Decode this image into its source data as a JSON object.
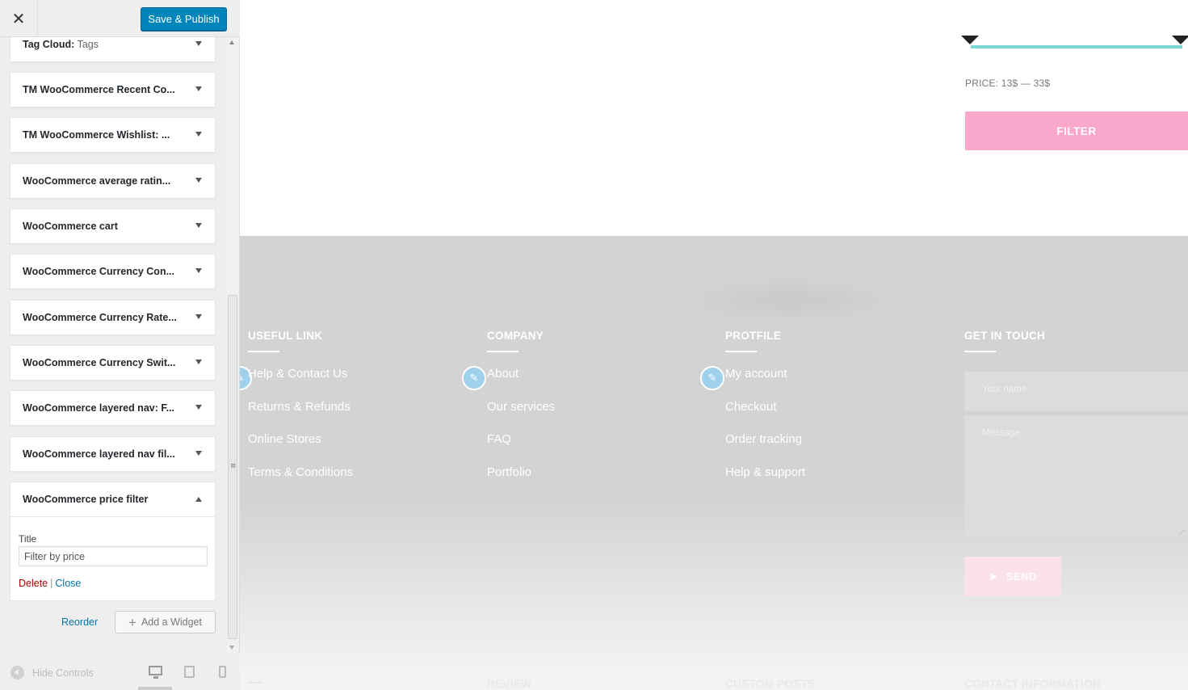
{
  "sidebar": {
    "header": {
      "close_label": "✕",
      "publish_label": "Save & Publish"
    },
    "widgets": [
      {
        "title": "Tag Cloud:",
        "subtitle": " Tags"
      },
      {
        "title": "TM WooCommerce Recent Co..."
      },
      {
        "title": "TM WooCommerce Wishlist: ..."
      },
      {
        "title": "WooCommerce average ratin..."
      },
      {
        "title": "WooCommerce cart"
      },
      {
        "title": "WooCommerce Currency Con..."
      },
      {
        "title": "WooCommerce Currency Rate..."
      },
      {
        "title": "WooCommerce Currency Swit..."
      },
      {
        "title": "WooCommerce layered nav: F..."
      },
      {
        "title": "WooCommerce layered nav fil..."
      }
    ],
    "open_widget": {
      "title": "WooCommerce price filter",
      "field_label": "Title",
      "field_value": "Filter by price",
      "delete_label": "Delete",
      "separator": "|",
      "close_label": "Close"
    },
    "reorder_label": "Reorder",
    "add_widget_label": "Add a Widget",
    "hide_controls_label": "Hide Controls"
  },
  "preview": {
    "price_label": "PRICE: 13$ — 33$",
    "filter_label": "FILTER",
    "columns": [
      {
        "title": "USEFUL LINK",
        "links": [
          "Help & Contact Us",
          "Returns & Refunds",
          "Online Stores",
          "Terms & Conditions"
        ]
      },
      {
        "title": "COMPANY",
        "links": [
          "About",
          "Our services",
          "FAQ",
          "Portfolio"
        ]
      },
      {
        "title": "PROTFILE",
        "links": [
          "My account",
          "Checkout",
          "Order tracking",
          "Help & support"
        ]
      }
    ],
    "contact": {
      "title": "GET IN TOUCH",
      "name_placeholder": "Your name",
      "message_placeholder": "Message",
      "send_label": "SEND"
    },
    "bottom_titles": [
      "REVIEW",
      "CUSTOM POSTS",
      "CONTACT INFORMATION"
    ]
  },
  "colors": {
    "publish": "#0085ba",
    "filter": "#f9a8cb",
    "slider": "#7ad7d4",
    "footer": "#d3d3d3"
  }
}
